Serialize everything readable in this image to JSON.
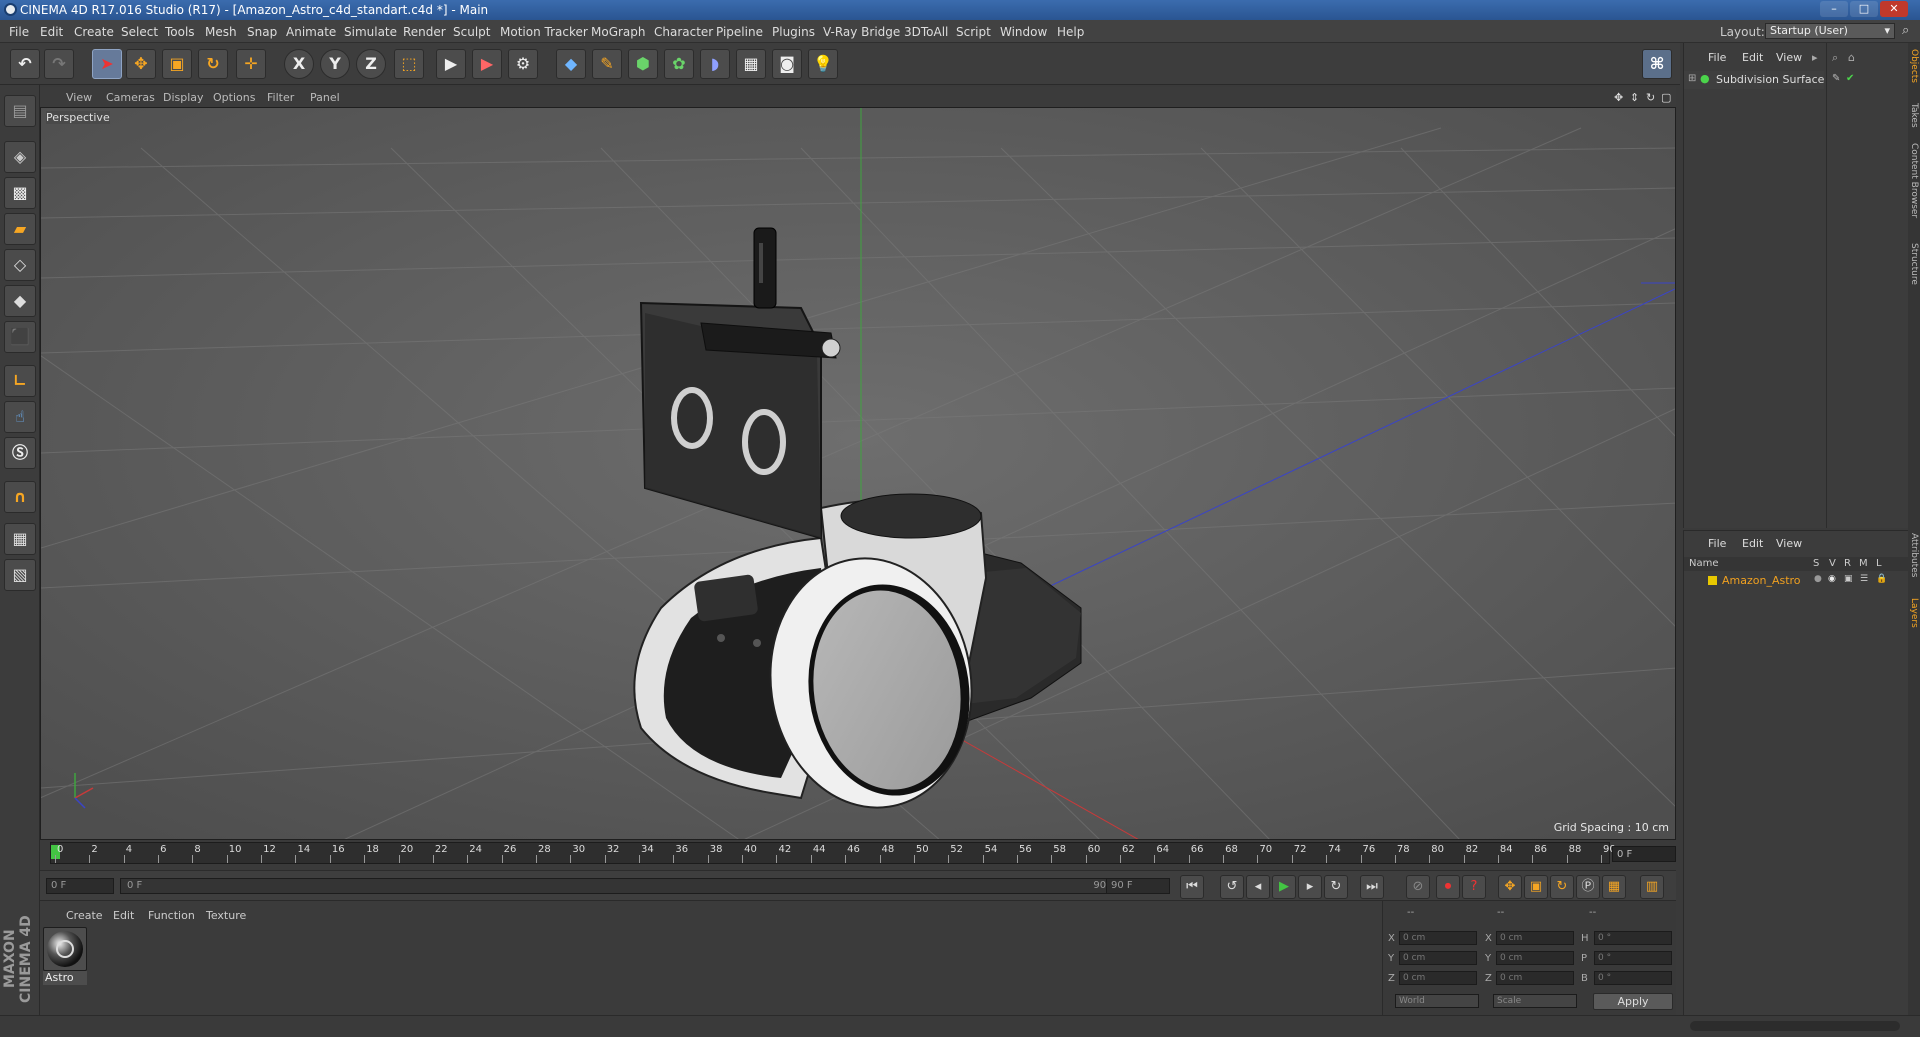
{
  "window": {
    "title": "CINEMA 4D R17.016 Studio (R17) - [Amazon_Astro_c4d_standart.c4d *] - Main",
    "controls": [
      "–",
      "□",
      "✕"
    ]
  },
  "menu": {
    "items": [
      "File",
      "Edit",
      "Create",
      "Select",
      "Tools",
      "Mesh",
      "Snap",
      "Animate",
      "Simulate",
      "Render",
      "Sculpt",
      "Motion Tracker",
      "MoGraph",
      "Character",
      "Pipeline",
      "Plugins",
      "V-Ray Bridge",
      "3DToAll",
      "Script",
      "Window",
      "Help"
    ],
    "layout_label": "Layout:",
    "layout_value": "Startup (User)"
  },
  "toolbar": {
    "axis_x": "X",
    "axis_y": "Y",
    "axis_z": "Z"
  },
  "viewport": {
    "menu": [
      "View",
      "Cameras",
      "Display",
      "Options",
      "Filter",
      "Panel"
    ],
    "camera_label": "Perspective",
    "grid_spacing": "Grid Spacing : 10 cm"
  },
  "timeline": {
    "ticks": [
      "0",
      "2",
      "4",
      "6",
      "8",
      "10",
      "12",
      "14",
      "16",
      "18",
      "20",
      "22",
      "24",
      "26",
      "28",
      "30",
      "32",
      "34",
      "36",
      "38",
      "40",
      "42",
      "44",
      "46",
      "48",
      "50",
      "52",
      "54",
      "56",
      "58",
      "60",
      "62",
      "64",
      "66",
      "68",
      "70",
      "72",
      "74",
      "76",
      "78",
      "80",
      "82",
      "84",
      "86",
      "88",
      "90"
    ],
    "current_frame": "0 F",
    "start_field": "0 F",
    "range_left": "0 F",
    "range_right": "90 F",
    "end_field": "90 F"
  },
  "materials": {
    "menu": [
      "Create",
      "Edit",
      "Function",
      "Texture"
    ],
    "items": [
      {
        "name": "Astro"
      }
    ]
  },
  "coordinates": {
    "header": [
      "--",
      "--",
      "--"
    ],
    "rows": [
      {
        "pos_label": "X",
        "pos": "0 cm",
        "size_label": "X",
        "size": "0 cm",
        "rot_label": "H",
        "rot": "0 °"
      },
      {
        "pos_label": "Y",
        "pos": "0 cm",
        "size_label": "Y",
        "size": "0 cm",
        "rot_label": "P",
        "rot": "0 °"
      },
      {
        "pos_label": "Z",
        "pos": "0 cm",
        "size_label": "Z",
        "size": "0 cm",
        "rot_label": "B",
        "rot": "0 °"
      }
    ],
    "mode_world": "World",
    "mode_scale": "Scale",
    "apply_label": "Apply"
  },
  "object_manager": {
    "menu": [
      "File",
      "Edit",
      "View"
    ],
    "objects": [
      {
        "name": "Subdivision Surface"
      }
    ]
  },
  "layer_manager": {
    "menu": [
      "File",
      "Edit",
      "View"
    ],
    "columns": [
      "Name",
      "S",
      "V",
      "R",
      "M",
      "L"
    ],
    "layers": [
      {
        "name": "Amazon_Astro",
        "color": "#e8c800"
      }
    ]
  },
  "right_tabs": [
    "Objects",
    "Takes",
    "Content Browser",
    "Structure",
    "Attributes",
    "Layers"
  ],
  "brand": "MAXON CINEMA 4D",
  "colors": {
    "accent_orange": "#f6a623",
    "title_blue": "#2f5c9a",
    "layer_name": "#f0a020"
  }
}
